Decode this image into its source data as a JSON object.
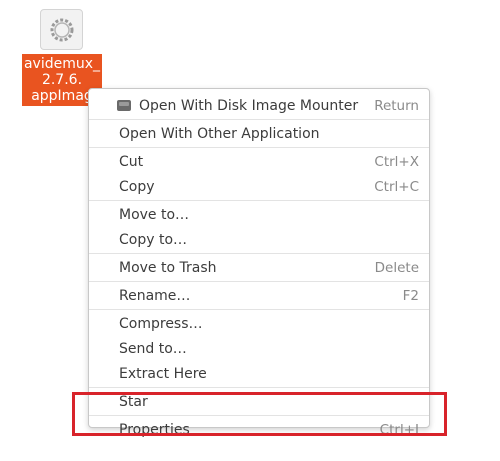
{
  "desktop_file": {
    "label_lines": [
      "avidemux_",
      "2.7.6.",
      "appImag"
    ],
    "icon": "gear-icon"
  },
  "menu": {
    "sections": [
      [
        {
          "label": "Open With Disk Image Mounter",
          "accel": "Return",
          "icon": "drive-icon"
        }
      ],
      [
        {
          "label": "Open With Other Application",
          "accel": ""
        }
      ],
      [
        {
          "label": "Cut",
          "accel": "Ctrl+X"
        },
        {
          "label": "Copy",
          "accel": "Ctrl+C"
        }
      ],
      [
        {
          "label": "Move to…",
          "accel": ""
        },
        {
          "label": "Copy to…",
          "accel": ""
        }
      ],
      [
        {
          "label": "Move to Trash",
          "accel": "Delete"
        }
      ],
      [
        {
          "label": "Rename…",
          "accel": "F2"
        }
      ],
      [
        {
          "label": "Compress…",
          "accel": ""
        },
        {
          "label": "Send to…",
          "accel": ""
        },
        {
          "label": "Extract Here",
          "accel": ""
        }
      ],
      [
        {
          "label": "Star",
          "accel": ""
        }
      ],
      [
        {
          "label": "Properties",
          "accel": "Ctrl+I"
        }
      ]
    ]
  },
  "highlight_color": "#d8232a",
  "accent_color": "#e95420"
}
